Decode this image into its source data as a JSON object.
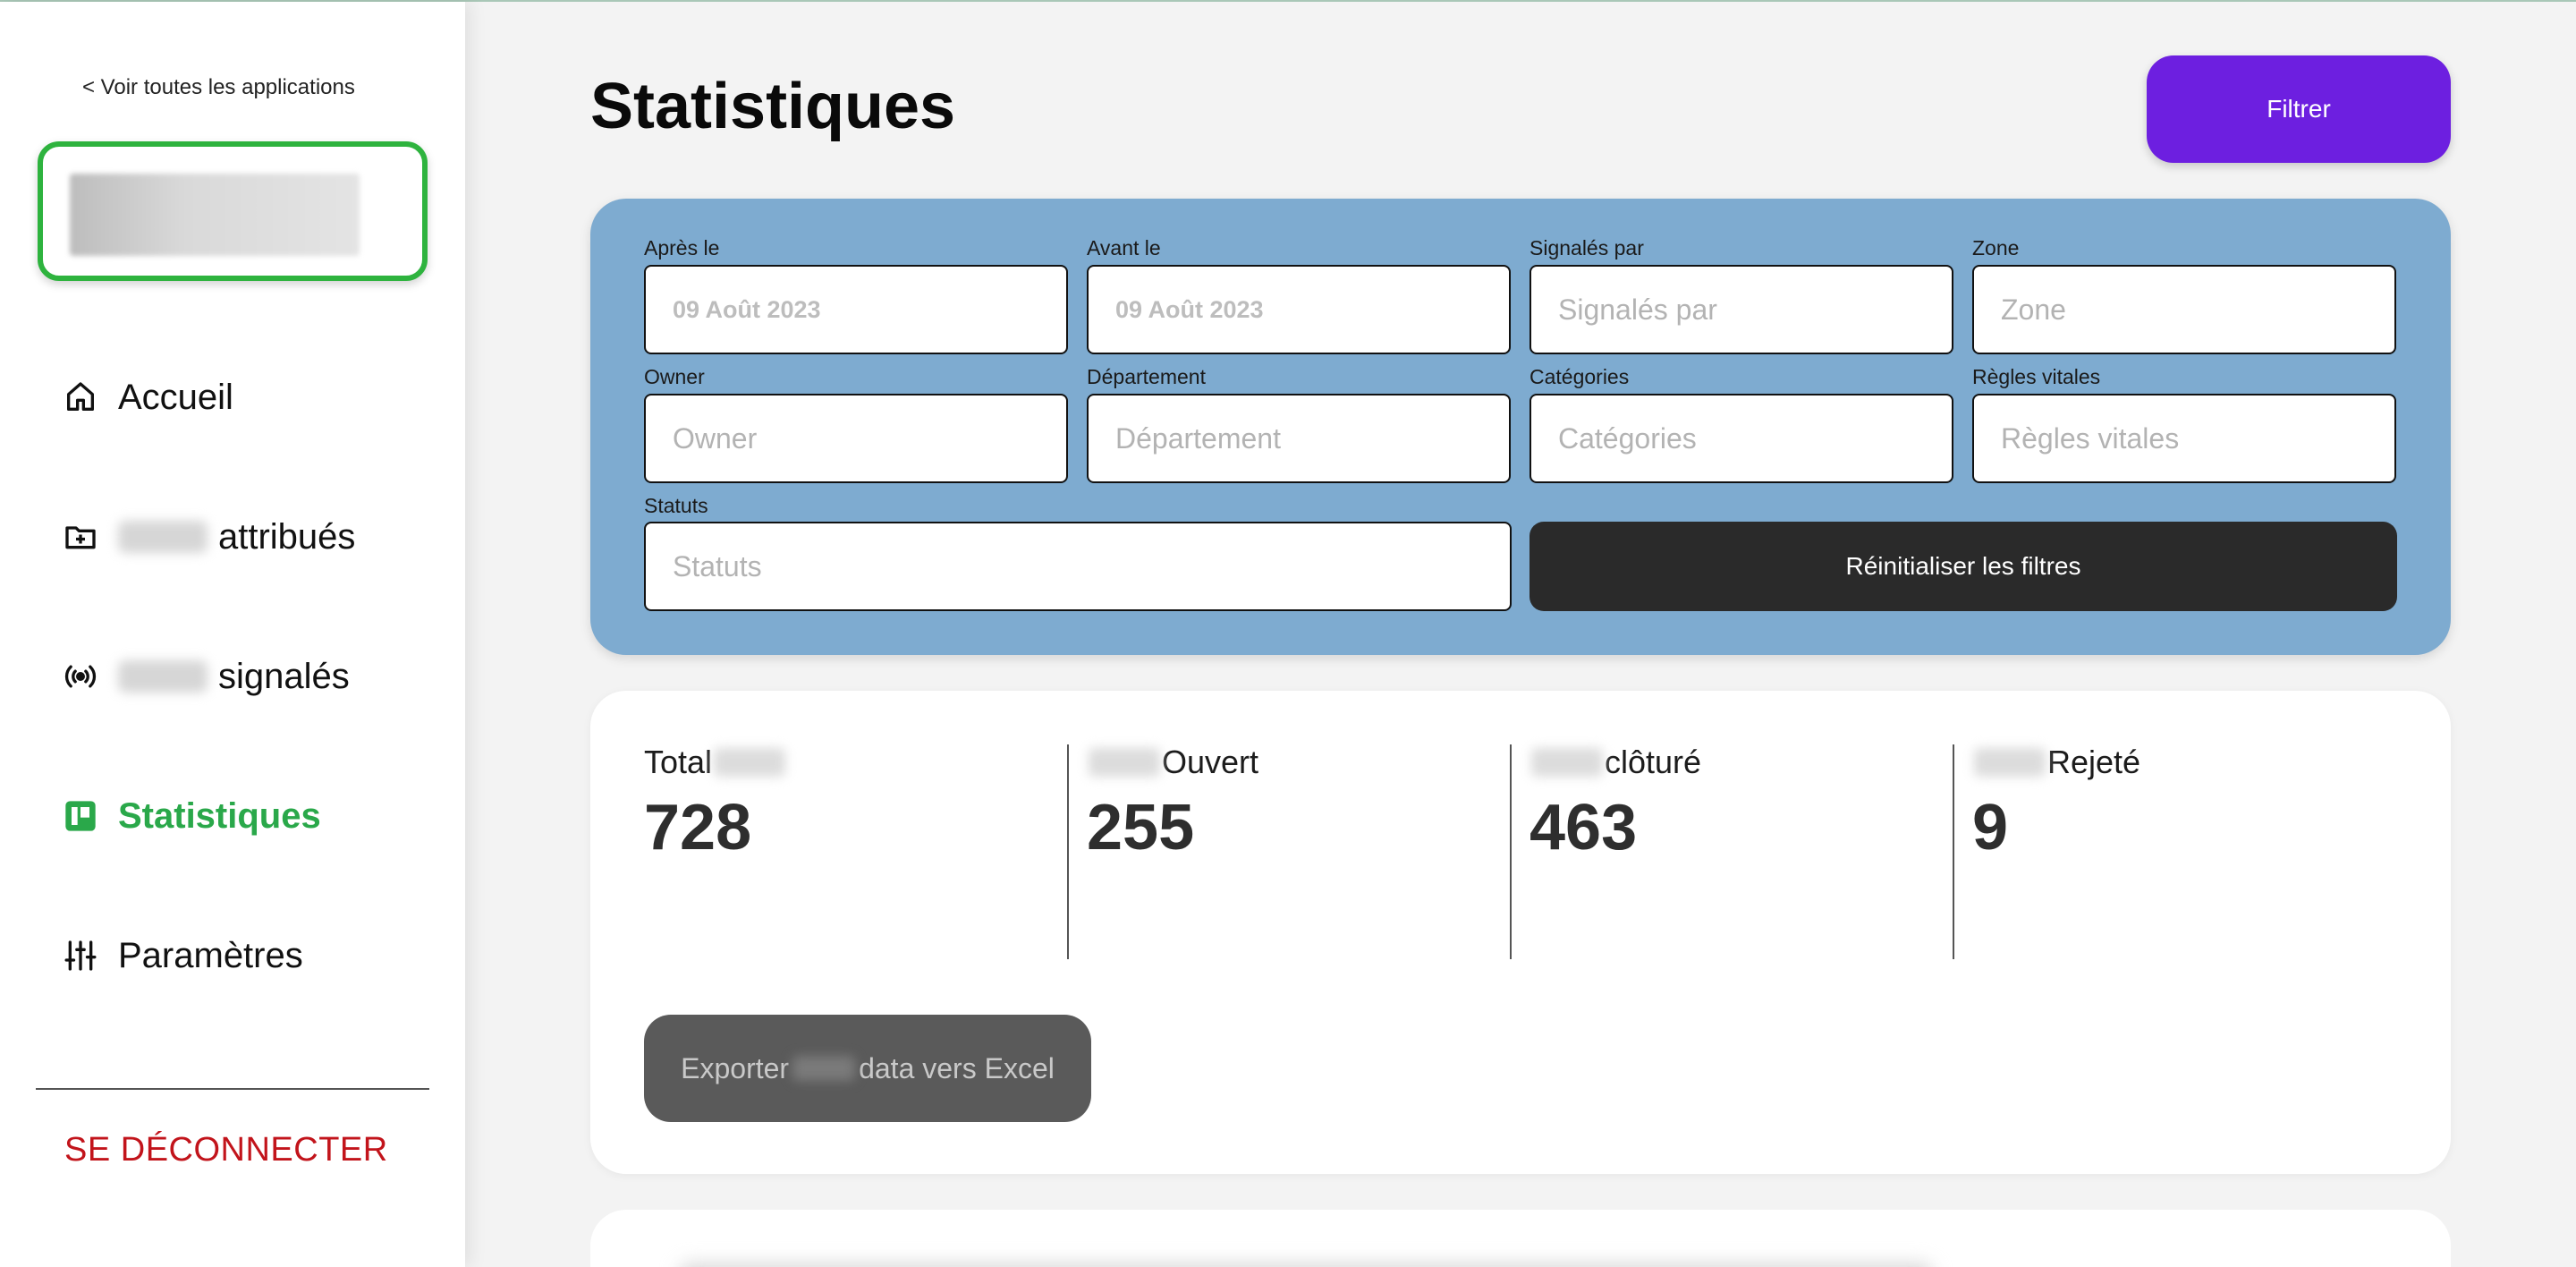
{
  "sidebar": {
    "back_link": "< Voir toutes les applications",
    "nav": [
      {
        "label": "Accueil",
        "icon": "home-icon"
      },
      {
        "label": "attribués",
        "icon": "folder-plus-icon"
      },
      {
        "label": "signalés",
        "icon": "broadcast-icon"
      },
      {
        "label": "Statistiques",
        "icon": "board-icon",
        "active": true
      },
      {
        "label": "Paramètres",
        "icon": "sliders-icon"
      }
    ],
    "logout": "SE DÉCONNECTER"
  },
  "header": {
    "title": "Statistiques",
    "filter_button": "Filtrer"
  },
  "filters": {
    "after": {
      "label": "Après le",
      "value": "09 Août 2023"
    },
    "before": {
      "label": "Avant le",
      "value": "09 Août 2023"
    },
    "reported_by": {
      "label": "Signalés par",
      "placeholder": "Signalés par"
    },
    "zone": {
      "label": "Zone",
      "placeholder": "Zone"
    },
    "owner": {
      "label": "Owner",
      "placeholder": "Owner"
    },
    "department": {
      "label": "Département",
      "placeholder": "Département"
    },
    "categories": {
      "label": "Catégories",
      "placeholder": "Catégories"
    },
    "rules": {
      "label": "Règles vitales",
      "placeholder": "Règles vitales"
    },
    "statuses": {
      "label": "Statuts",
      "placeholder": "Statuts"
    },
    "reset_button": "Réinitialiser les filtres"
  },
  "stats": {
    "total": {
      "label": "Total",
      "value": "728"
    },
    "open": {
      "label": "Ouvert",
      "value": "255"
    },
    "closed": {
      "label": "clôturé",
      "value": "463"
    },
    "rejected": {
      "label": "Rejeté",
      "value": "9"
    },
    "export_prefix": "Exporter",
    "export_suffix": "data vers Excel"
  },
  "colors": {
    "accent": "#6d1fe0",
    "active_nav": "#2aa84a",
    "filter_panel": "#7eabd0",
    "logout": "#c2141b"
  }
}
